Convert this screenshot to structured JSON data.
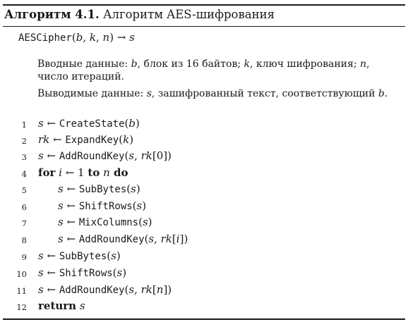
{
  "title": {
    "number": "Алгоритм 4.1.",
    "text": "Алгоритм AES-шифрования"
  },
  "signature": {
    "func": "AESCipher",
    "open": "(",
    "a1": "b",
    "c1": ", ",
    "a2": "k",
    "c2": ", ",
    "a3": "n",
    "close": ")",
    "arrow": " → ",
    "ret": "s"
  },
  "input": {
    "label": "Вводные данные: ",
    "b": "b",
    "b_desc": ", блок из 16 байтов; ",
    "k": "k",
    "k_desc": ", ключ шифрования; ",
    "n": "n",
    "n_desc": ", число итераций."
  },
  "output": {
    "label": "Выводимые данные: ",
    "s": "s",
    "s_desc": ", зашифрованный текст, соответствующий ",
    "b": "b",
    "end": "."
  },
  "code": {
    "l1": {
      "num": "1",
      "var": "s",
      "arrow": " ← ",
      "fn": "CreateState",
      "open": "(",
      "arg": "b",
      "close": ")"
    },
    "l2": {
      "num": "2",
      "var": "rk",
      "arrow": " ← ",
      "fn": "ExpandKey",
      "open": "(",
      "arg": "k",
      "close": ")"
    },
    "l3": {
      "num": "3",
      "var": "s",
      "arrow": " ← ",
      "fn": "AddRoundKey",
      "open": "(",
      "a1": "s",
      "sep": ", ",
      "a2": "rk",
      "idx": "[0]",
      "close": ")"
    },
    "l4": {
      "num": "4",
      "for": "for",
      "var": " i",
      "arrow": " ← 1 ",
      "to": "to",
      "n": " n",
      "do": " do"
    },
    "l5": {
      "num": "5",
      "var": "s",
      "arrow": " ← ",
      "fn": "SubBytes",
      "open": "(",
      "arg": "s",
      "close": ")"
    },
    "l6": {
      "num": "6",
      "var": "s",
      "arrow": " ← ",
      "fn": "ShiftRows",
      "open": "(",
      "arg": "s",
      "close": ")"
    },
    "l7": {
      "num": "7",
      "var": "s",
      "arrow": " ← ",
      "fn": "MixColumns",
      "open": "(",
      "arg": "s",
      "close": ")"
    },
    "l8": {
      "num": "8",
      "var": "s",
      "arrow": " ← ",
      "fn": "AddRoundKey",
      "open": "(",
      "a1": "s",
      "sep": ", ",
      "a2": "rk",
      "lb": "[",
      "i": "i",
      "rb": "]",
      "close": ")"
    },
    "l9": {
      "num": "9",
      "var": "s",
      "arrow": " ← ",
      "fn": "SubBytes",
      "open": "(",
      "arg": "s",
      "close": ")"
    },
    "l10": {
      "num": "10",
      "var": "s",
      "arrow": " ← ",
      "fn": "ShiftRows",
      "open": "(",
      "arg": "s",
      "close": ")"
    },
    "l11": {
      "num": "11",
      "var": "s",
      "arrow": " ← ",
      "fn": "AddRoundKey",
      "open": "(",
      "a1": "s",
      "sep": ", ",
      "a2": "rk",
      "lb": "[",
      "n": "n",
      "rb": "]",
      "close": ")"
    },
    "l12": {
      "num": "12",
      "ret": "return",
      "var": " s"
    }
  }
}
